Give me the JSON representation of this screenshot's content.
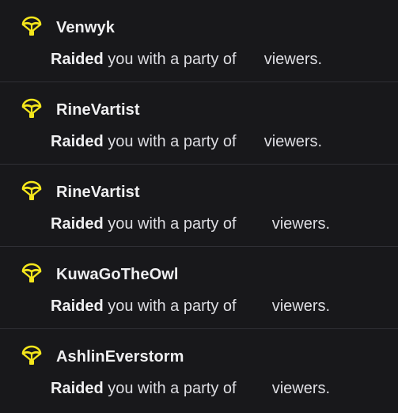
{
  "colors": {
    "background": "#18181b",
    "divider": "#2f2f35",
    "icon": "#f5e61c",
    "text": "#efeff1"
  },
  "icon_name": "raid-parachute-icon",
  "raids": [
    {
      "username": "Venwyk",
      "verb": "Raided",
      "text_before": "you with a party of",
      "viewer_count": "",
      "text_after": "viewers."
    },
    {
      "username": "RineVartist",
      "verb": "Raided",
      "text_before": "you with a party of",
      "viewer_count": "",
      "text_after": "viewers."
    },
    {
      "username": "RineVartist",
      "verb": "Raided",
      "text_before": "you with a party of",
      "viewer_count": "",
      "text_after": "viewers."
    },
    {
      "username": "KuwaGoTheOwl",
      "verb": "Raided",
      "text_before": "you with a party of",
      "viewer_count": "",
      "text_after": "viewers."
    },
    {
      "username": "AshlinEverstorm",
      "verb": "Raided",
      "text_before": "you with a party of",
      "viewer_count": "",
      "text_after": "viewers."
    }
  ]
}
